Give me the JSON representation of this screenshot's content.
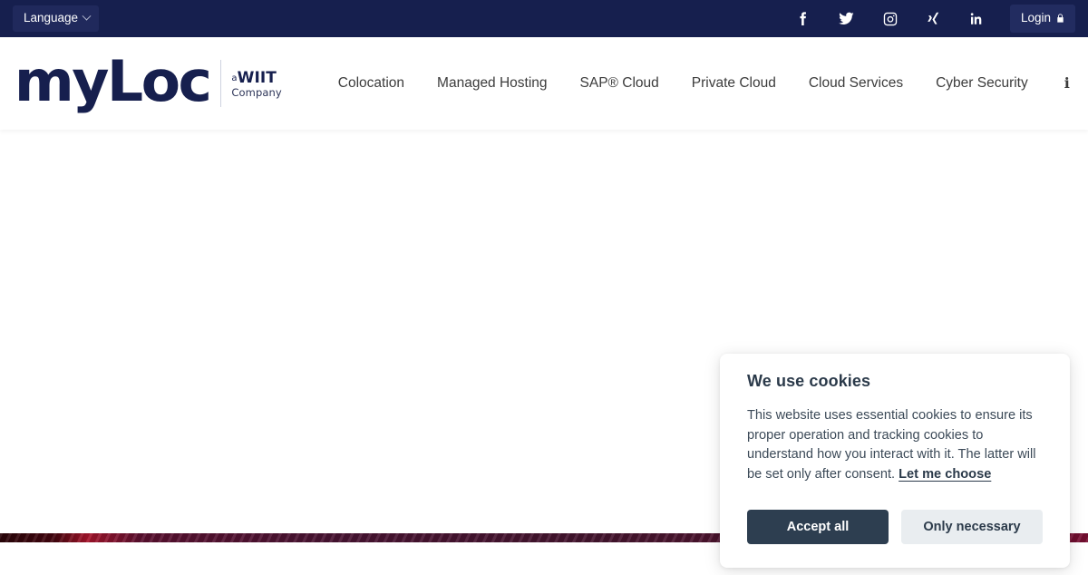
{
  "topbar": {
    "language_label": "Language",
    "language_caret_icon": "chevron-down-icon",
    "login_label": "Login",
    "login_lock_icon": "lock-icon",
    "social": [
      {
        "name": "facebook-icon",
        "label": "Facebook"
      },
      {
        "name": "twitter-icon",
        "label": "Twitter"
      },
      {
        "name": "instagram-icon",
        "label": "Instagram"
      },
      {
        "name": "xing-icon",
        "label": "Xing"
      },
      {
        "name": "linkedin-icon",
        "label": "LinkedIn"
      }
    ]
  },
  "header": {
    "logo": {
      "mark": "myLoc",
      "tag_line1_prefix": "a",
      "tag_line1": "WIIT",
      "tag_line2": "Company"
    },
    "nav": [
      {
        "label": "Colocation"
      },
      {
        "label": "Managed Hosting"
      },
      {
        "label": "SAP® Cloud"
      },
      {
        "label": "Private Cloud"
      },
      {
        "label": "Cloud Services"
      },
      {
        "label": "Cyber Security"
      }
    ],
    "info_icon_label": "i"
  },
  "cookie": {
    "title": "We use cookies",
    "body_part1": "This website uses essential cookies to ensure its proper operation and tracking cookies to understand how you interact with it. The latter will be set only after consent. ",
    "choose_link": "Let me choose",
    "accept_label": "Accept all",
    "necessary_label": "Only necessary"
  },
  "colors": {
    "topbar_bg": "#161f4e",
    "brand_navy": "#161f4e",
    "accept_btn_bg": "#2d3e50",
    "necessary_btn_bg": "#e9edf0",
    "stripe_accent": "#a8152c"
  }
}
